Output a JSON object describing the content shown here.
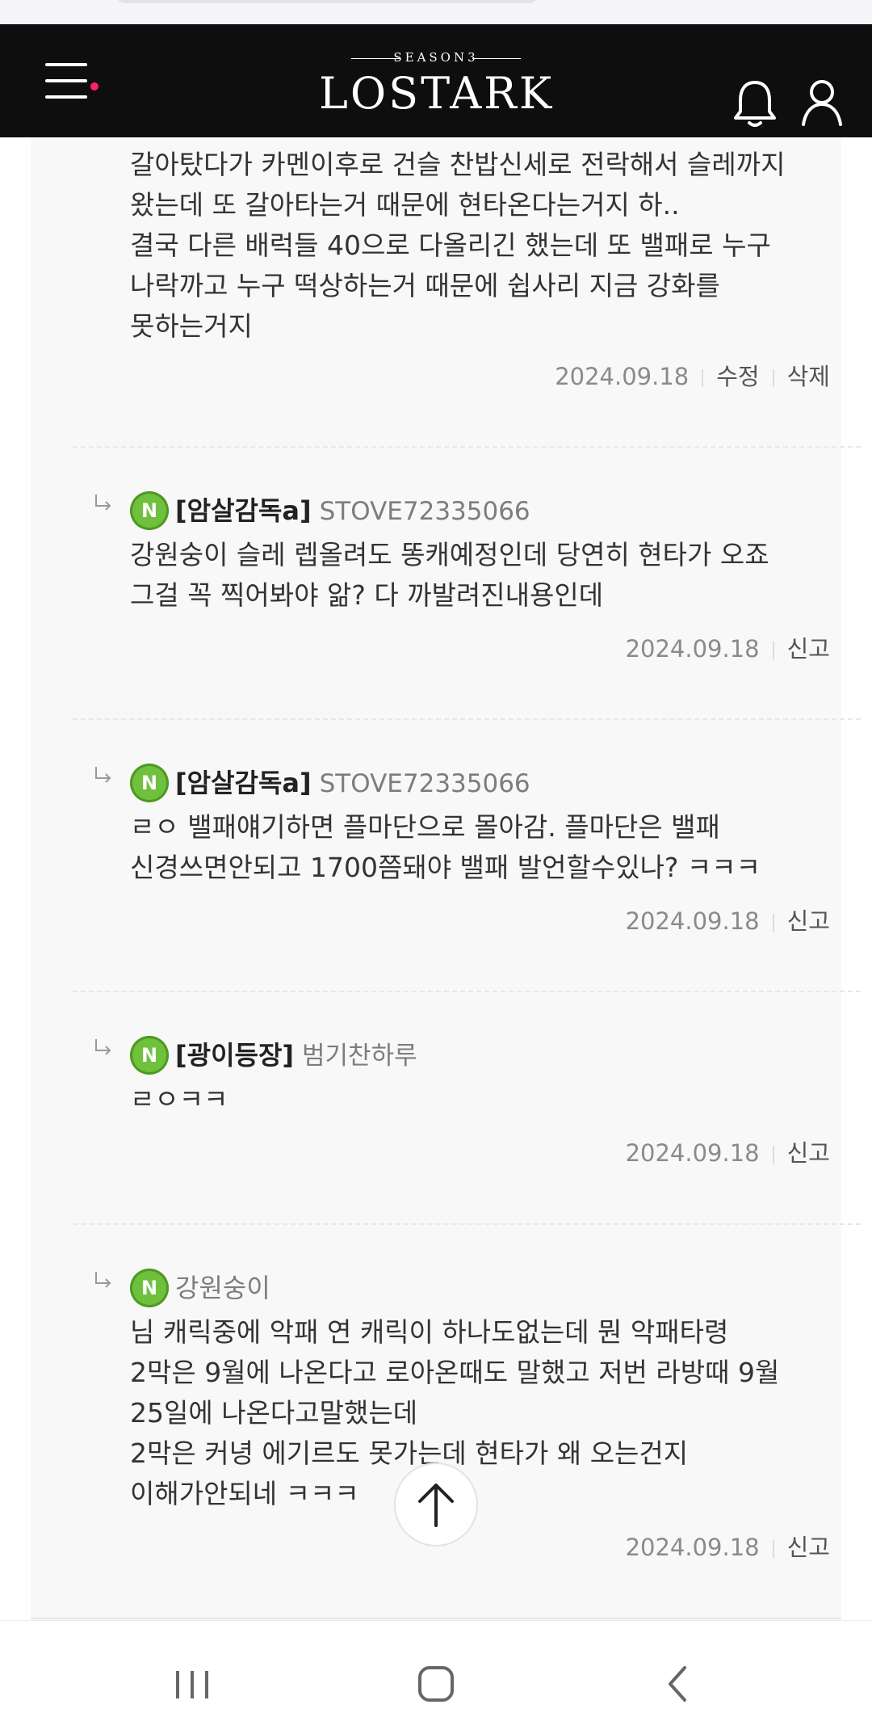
{
  "header": {
    "logo_season": "SEASON3",
    "logo_text": "LOSTARK",
    "menu_icon": "hamburger-menu-icon",
    "notification_icon": "bell-icon",
    "profile_icon": "user-icon",
    "accent_dot_color": "#ff1f72"
  },
  "comments": [
    {
      "lines": [
        "갈아탔다가 카멘이후로 건슬 찬밥신세로 전락해서 슬레까지",
        "왔는데 또 갈아타는거 때문에 현타온다는거지 하..",
        "결국 다른 배럭들 40으로 다올리긴 했는데 또 밸패로 누구",
        "나락까고 누구 떡상하는거 때문에 쉽사리 지금 강화를",
        "못하는거지"
      ],
      "date": "2024.09.18",
      "actions": [
        "수정",
        "삭제"
      ]
    },
    {
      "badge": "N",
      "author": "[암살감독a]",
      "author_id": "STOVE72335066",
      "lines": [
        "강원숭이 슬레 렙올려도 똥캐예정인데 당연히 현타가 오죠",
        "그걸 꼭 찍어봐야 앎? 다 까발려진내용인데"
      ],
      "date": "2024.09.18",
      "actions": [
        "신고"
      ]
    },
    {
      "badge": "N",
      "author": "[암살감독a]",
      "author_id": "STOVE72335066",
      "lines": [
        "ㄹㅇ 밸패얘기하면 플마단으로 몰아감. 플마단은 밸패",
        "신경쓰면안되고 1700쯤돼야 밸패 발언할수있나? ㅋㅋㅋ"
      ],
      "date": "2024.09.18",
      "actions": [
        "신고"
      ]
    },
    {
      "badge": "N",
      "author": "[광이등장]",
      "author_id": "범기찬하루",
      "lines": [
        "ㄹㅇㅋㅋ"
      ],
      "date": "2024.09.18",
      "actions": [
        "신고"
      ]
    },
    {
      "badge": "N",
      "author": "강원숭이",
      "lines": [
        "님 캐릭중에 악패 연 캐릭이 하나도없는데 뭔 악패타령",
        "2막은 9월에 나온다고 로아온때도 말했고 저번 라방때 9월",
        "25일에 나온다고말했는데",
        "2막은 커녕 에기르도 못가는데 현타가 왜 오는건지",
        "이해가안되네 ㅋㅋㅋ"
      ],
      "date": "2024.09.18",
      "actions": [
        "신고"
      ]
    }
  ],
  "scroll_top_icon": "arrow-up-icon",
  "system_nav": {
    "recents_icon": "recent-apps-icon",
    "home_icon": "home-icon",
    "back_icon": "back-icon"
  }
}
